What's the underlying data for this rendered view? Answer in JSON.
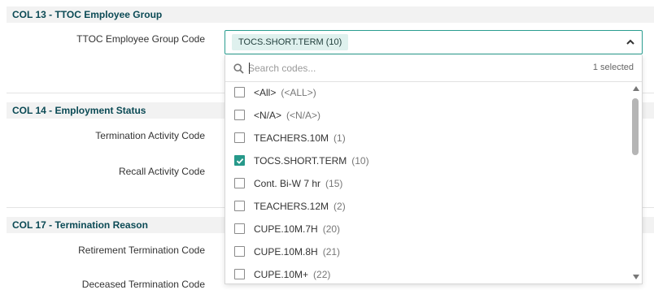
{
  "sections": [
    {
      "title": "COL 13 - TTOC Employee Group"
    },
    {
      "title": "COL 14 - Employment Status"
    },
    {
      "title": "COL 17 - Termination Reason"
    }
  ],
  "fields": {
    "ttoc_group_code": "TTOC Employee Group Code",
    "termination_activity_code": "Termination Activity Code",
    "recall_activity_code": "Recall Activity Code",
    "retirement_termination_code": "Retirement Termination Code",
    "partial_label": "Deceased Termination Code"
  },
  "select": {
    "selected_chip": "TOCS.SHORT.TERM (10)",
    "search_placeholder": "Search codes...",
    "selected_count": "1 selected"
  },
  "options": [
    {
      "label": "<All>",
      "count": "(<ALL>)",
      "checked": false
    },
    {
      "label": "<N/A>",
      "count": "(<N/A>)",
      "checked": false
    },
    {
      "label": "TEACHERS.10M",
      "count": "(1)",
      "checked": false
    },
    {
      "label": "TOCS.SHORT.TERM",
      "count": "(10)",
      "checked": true
    },
    {
      "label": "Cont. Bi-W 7 hr",
      "count": "(15)",
      "checked": false
    },
    {
      "label": "TEACHERS.12M",
      "count": "(2)",
      "checked": false
    },
    {
      "label": "CUPE.10M.7H",
      "count": "(20)",
      "checked": false
    },
    {
      "label": "CUPE.10M.8H",
      "count": "(21)",
      "checked": false
    },
    {
      "label": "CUPE.10M+",
      "count": "(22)",
      "checked": false
    }
  ],
  "colors": {
    "accent": "#26998a",
    "section_title": "#0b4a55",
    "chip_bg": "#dff1ee"
  },
  "icons": {
    "search": "search-icon",
    "caret": "chevron-up-icon",
    "check": "check-icon"
  }
}
